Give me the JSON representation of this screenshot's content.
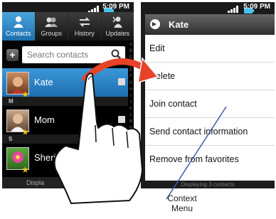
{
  "status": {
    "time": "5:09 PM"
  },
  "tabs": [
    {
      "label": "Contacts",
      "icon": "person-icon"
    },
    {
      "label": "Groups",
      "icon": "group-icon"
    },
    {
      "label": "History",
      "icon": "history-icon"
    },
    {
      "label": "Updates",
      "icon": "updates-icon"
    }
  ],
  "search": {
    "placeholder": "Search contacts"
  },
  "sections": [
    "M",
    "S"
  ],
  "contacts": [
    {
      "name": "Kate"
    },
    {
      "name": "Mom"
    },
    {
      "name": "Sheri"
    }
  ],
  "display_bar": "Displa",
  "context_menu": {
    "title": "Kate",
    "items": [
      "Edit",
      "Delete",
      "Join contact",
      "Send contact information",
      "Remove from favorites"
    ]
  },
  "right_bottom_text": "Displaying 3 contacts",
  "callout": {
    "line1": "Context",
    "line2": "Menu"
  },
  "colors": {
    "highlight": "#2a86c8",
    "arrow": "#e8432a"
  }
}
